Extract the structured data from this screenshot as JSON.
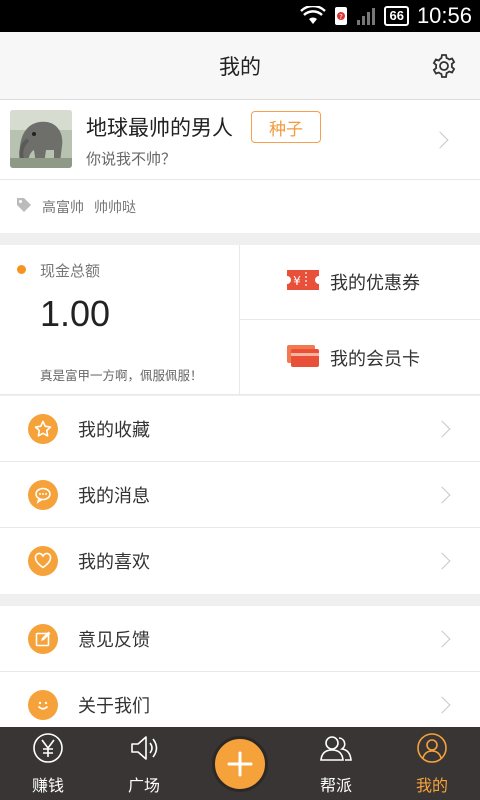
{
  "status": {
    "battery": "66",
    "time": "10:56"
  },
  "header": {
    "title": "我的"
  },
  "profile": {
    "name": "地球最帅的男人",
    "badge": "种子",
    "signature": "你说我不帅？"
  },
  "tags": [
    "高富帅",
    "帅帅哒"
  ],
  "cash": {
    "label": "现金总额",
    "amount": "1.00",
    "note": "真是富甲一方啊，佩服佩服！"
  },
  "coupons": {
    "label": "我的优惠券"
  },
  "member_card": {
    "label": "我的会员卡"
  },
  "menu1": [
    {
      "label": "我的收藏",
      "icon": "star-icon"
    },
    {
      "label": "我的消息",
      "icon": "chat-icon"
    },
    {
      "label": "我的喜欢",
      "icon": "heart-icon"
    }
  ],
  "menu2": [
    {
      "label": "意见反馈",
      "icon": "edit-icon"
    },
    {
      "label": "关于我们",
      "icon": "smile-icon"
    }
  ],
  "tabbar": {
    "items": [
      {
        "label": "赚钱",
        "icon": "yen-icon"
      },
      {
        "label": "广场",
        "icon": "speaker-icon"
      },
      {
        "label": "",
        "icon": "plus-icon"
      },
      {
        "label": "帮派",
        "icon": "group-icon"
      },
      {
        "label": "我的",
        "icon": "user-icon"
      }
    ]
  },
  "colors": {
    "accent": "#f6a23a",
    "tabbar_bg": "#3a3535",
    "coupon_red": "#e8503a"
  }
}
